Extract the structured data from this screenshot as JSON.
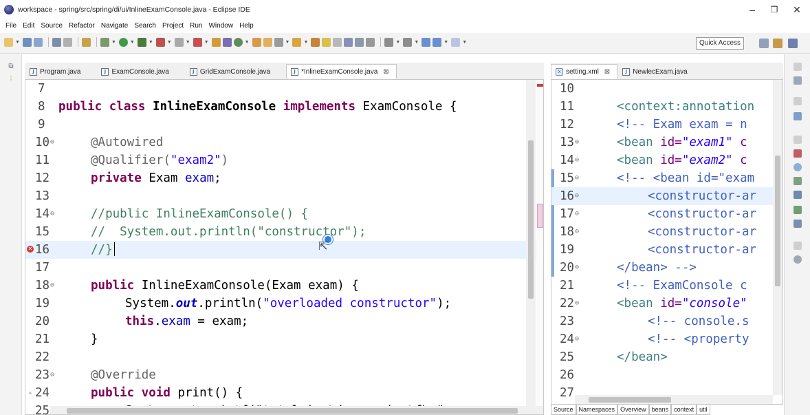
{
  "window": {
    "title": "workspace - spring/src/spring/di/ui/InlineExamConsole.java - Eclipse IDE",
    "minimize": "–",
    "maximize": "❐",
    "close": "✕"
  },
  "menu": [
    "File",
    "Edit",
    "Source",
    "Refactor",
    "Navigate",
    "Search",
    "Project",
    "Run",
    "Window",
    "Help"
  ],
  "toolbar": {
    "quick_access": "Quick Access"
  },
  "left_editor": {
    "tabs": [
      {
        "label": "Program.java",
        "active": false
      },
      {
        "label": "ExamConsole.java",
        "active": false
      },
      {
        "label": "GridExamConsole.java",
        "active": false
      },
      {
        "label": "*InlineExamConsole.java",
        "active": true
      }
    ],
    "tab_close": "⊠",
    "line_numbers": [
      "7",
      "8",
      "9",
      "10",
      "11",
      "12",
      "13",
      "14",
      "15",
      "16",
      "17",
      "18",
      "19",
      "20",
      "21",
      "22",
      "23",
      "24",
      "25"
    ],
    "lines": {
      "l8": {
        "kw1": "public",
        "kw2": "class",
        "name": "InlineExamConsole",
        "kw3": "implements",
        "rest": "ExamConsole {"
      },
      "l10": "@Autowired",
      "l11a": "@Qualifier(",
      "l11b": "\"exam2\"",
      "l11c": ")",
      "l12a": "private",
      "l12b": "Exam",
      "l12c": "exam",
      "l12d": ";",
      "l14": "//public InlineExamConsole() {",
      "l15": "//  System.out.println(\"constructor\");",
      "l16": "//}",
      "l18a": "public",
      "l18b": "InlineExamConsole(Exam exam) {",
      "l19a": "System.",
      "l19b": "out",
      "l19c": ".println(",
      "l19d": "\"overloaded constructor\"",
      "l19e": ");",
      "l20a": "this",
      "l20b": ".",
      "l20c": "exam",
      "l20d": " = exam;",
      "l21": "}",
      "l23": "@Override",
      "l24a": "public",
      "l24b": "void",
      "l24c": "print() {",
      "l25": "System.out.printf(\"total is %d, avg is %f\\n\", exa"
    }
  },
  "right_editor": {
    "tabs": [
      {
        "label": "setting.xml",
        "active": true
      },
      {
        "label": "NewlecExam.java",
        "active": false
      }
    ],
    "tab_close": "⊠",
    "line_numbers": [
      "10",
      "11",
      "12",
      "13",
      "14",
      "15",
      "16",
      "17",
      "18",
      "19",
      "20",
      "21",
      "22",
      "23",
      "24",
      "25",
      "26",
      "27"
    ],
    "lines": {
      "l11": "<context:annotation",
      "l12": "<!-- Exam exam = n",
      "l13a": "<bean ",
      "l13b": "id=",
      "l13c": "\"exam1\"",
      "l13d": " c",
      "l14a": "<bean ",
      "l14b": "id=",
      "l14c": "\"exam2\"",
      "l14d": " c",
      "l15": "<!-- <bean id=\"exam",
      "l16": "<constructor-ar",
      "l17": "<constructor-ar",
      "l18": "<constructor-ar",
      "l19": "<constructor-ar",
      "l20": "</bean> -->",
      "l21": "<!-- ExamConsole c",
      "l22a": "<bean ",
      "l22b": "id=",
      "l22c": "\"console\"",
      "l23": "<!-- console.s",
      "l24": "<!-- <property",
      "l25": "</bean>"
    },
    "bottom_tabs": [
      "Source",
      "Namespaces",
      "Overview",
      "beans",
      "context",
      "util"
    ]
  }
}
